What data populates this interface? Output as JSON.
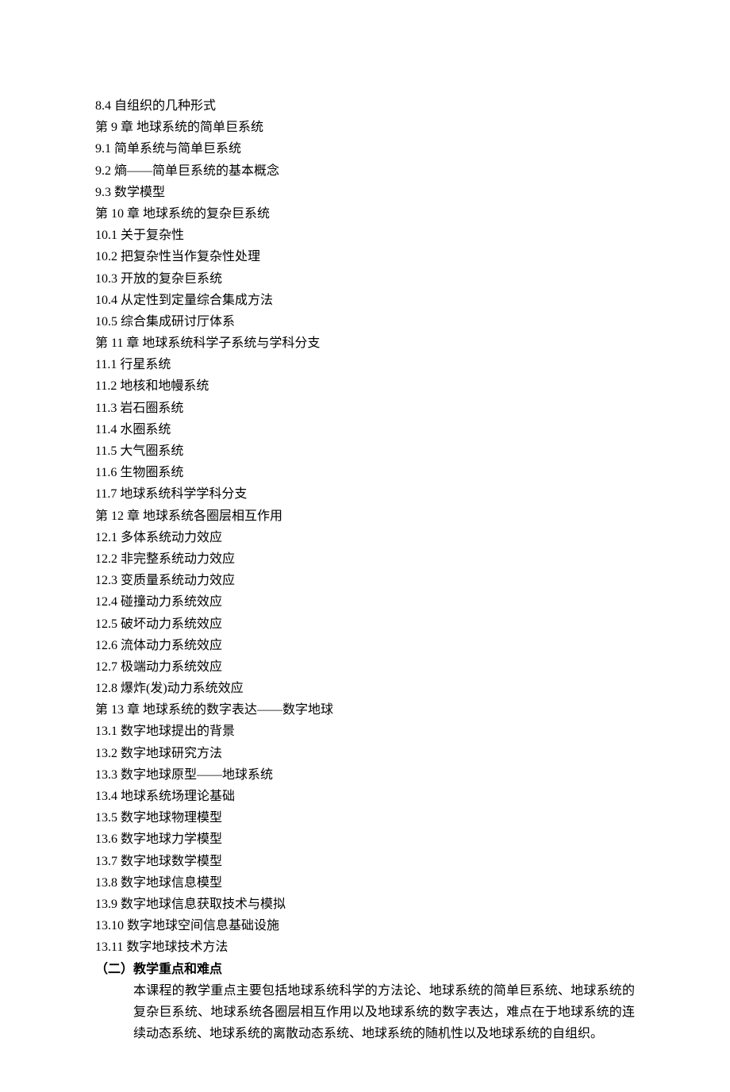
{
  "toc": [
    "8.4 自组织的几种形式",
    "第 9 章 地球系统的简单巨系统",
    "9.1 简单系统与简单巨系统",
    "9.2 熵——简单巨系统的基本概念",
    "9.3 数学模型",
    "第 10 章 地球系统的复杂巨系统",
    "10.1 关于复杂性",
    "10.2 把复杂性当作复杂性处理",
    "10.3 开放的复杂巨系统",
    "10.4 从定性到定量综合集成方法",
    "10.5 综合集成研讨厅体系",
    "第 11 章 地球系统科学子系统与学科分支",
    "11.1 行星系统",
    "11.2 地核和地幔系统",
    "11.3 岩石圈系统",
    "11.4 水圈系统",
    "11.5 大气圈系统",
    "11.6 生物圈系统",
    "11.7 地球系统科学学科分支",
    "第 12 章 地球系统各圈层相互作用",
    "12.1 多体系统动力效应",
    "12.2 非完整系统动力效应",
    "12.3 变质量系统动力效应",
    "12.4 碰撞动力系统效应",
    "12.5 破坏动力系统效应",
    "12.6 流体动力系统效应",
    "12.7 极端动力系统效应",
    "12.8 爆炸(发)动力系统效应",
    "第 13 章 地球系统的数字表达——数字地球",
    "13.1 数字地球提出的背景",
    "13.2 数字地球研究方法",
    "13.3 数字地球原型——地球系统",
    "13.4 地球系统场理论基础",
    "13.5 数字地球物理模型",
    "13.6 数字地球力学模型",
    "13.7 数字地球数学模型",
    "13.8 数字地球信息模型",
    "13.9 数字地球信息获取技术与模拟",
    "13.10 数字地球空间信息基础设施",
    "13.11 数字地球技术方法"
  ],
  "section": {
    "number": "（二）",
    "title": "教学重点和难点"
  },
  "keypoints": "本课程的教学重点主要包括地球系统科学的方法论、地球系统的简单巨系统、地球系统的复杂巨系统、地球系统各圈层相互作用以及地球系统的数字表达，难点在于地球系统的连续动态系统、地球系统的离散动态系统、地球系统的随机性以及地球系统的自组织。"
}
